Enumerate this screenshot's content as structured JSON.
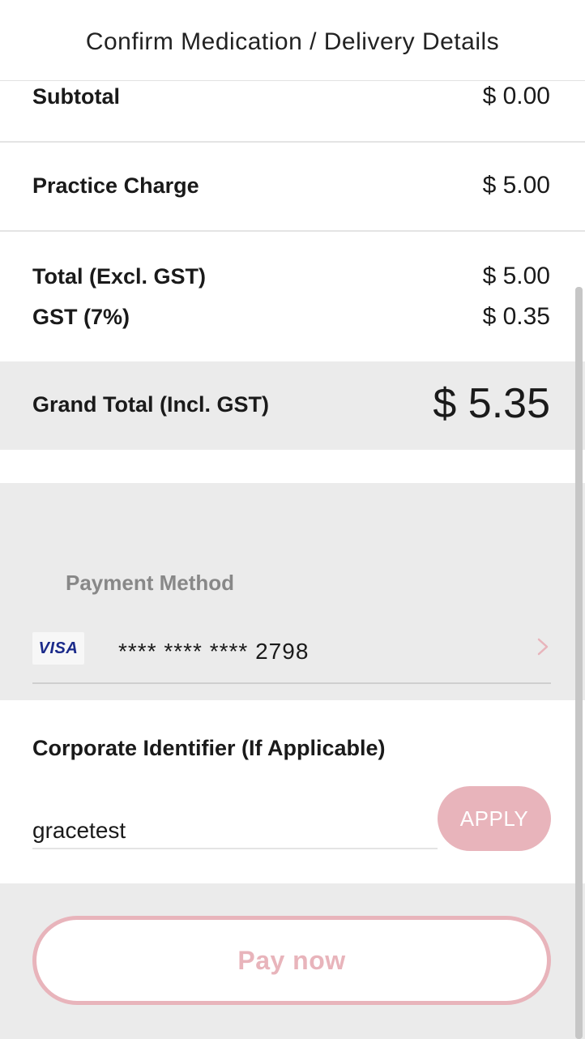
{
  "header": {
    "title": "Confirm Medication / Delivery Details"
  },
  "summary": {
    "subtotal": {
      "label": "Subtotal",
      "value": "$ 0.00"
    },
    "practice_charge": {
      "label": "Practice Charge",
      "value": "$ 5.00"
    },
    "total_excl_gst": {
      "label": "Total (Excl. GST)",
      "value": "$ 5.00"
    },
    "gst": {
      "label": "GST (7%)",
      "value": "$ 0.35"
    },
    "grand_total": {
      "label": "Grand Total (Incl. GST)",
      "value": "$ 5.35"
    }
  },
  "payment": {
    "label": "Payment Method",
    "card_brand": "VISA",
    "card_number": "**** **** **** 2798",
    "chevron_icon": "chevron-right-icon"
  },
  "corporate": {
    "label": "Corporate Identifier (If Applicable)",
    "input_value": "gracetest",
    "apply_label": "APPLY"
  },
  "footer": {
    "pay_label": "Pay now"
  },
  "colors": {
    "accent": "#e8b4bb",
    "panel": "#ebebeb",
    "visa_blue": "#1a2a8a"
  }
}
